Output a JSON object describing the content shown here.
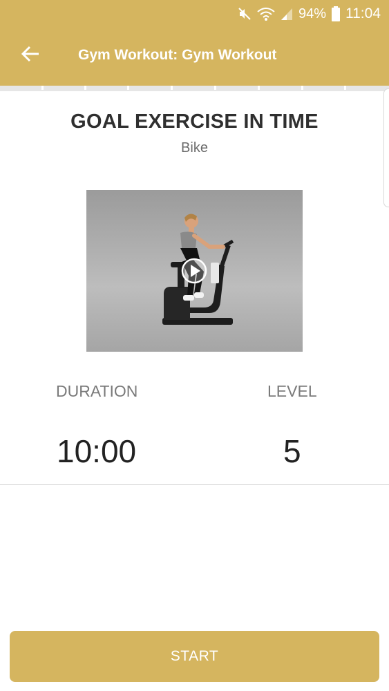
{
  "status_bar": {
    "battery_percent": "94%",
    "time": "11:04",
    "icons": [
      "mute-icon",
      "wifi-icon",
      "signal-icon",
      "battery-icon"
    ]
  },
  "app_bar": {
    "title": "Gym Workout: Gym Workout",
    "back_icon": "arrow-left-icon"
  },
  "progress": {
    "segments_total": 9
  },
  "exercise": {
    "goal_title": "GOAL EXERCISE IN TIME",
    "name": "Bike",
    "video_play_icon": "play-icon"
  },
  "stats": {
    "duration_label": "DURATION",
    "duration_value": "10:00",
    "level_label": "LEVEL",
    "level_value": "5"
  },
  "actions": {
    "start_label": "START"
  },
  "colors": {
    "accent": "#d5b55f",
    "text_dark": "#222222",
    "text_muted": "#7a7a7a"
  }
}
